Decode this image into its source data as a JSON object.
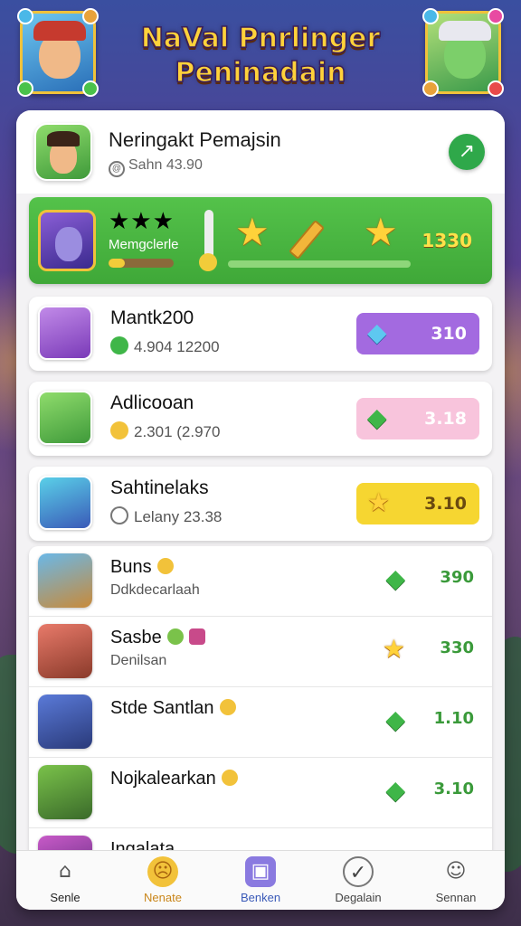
{
  "header": {
    "title_line1": "NaVal Pnrlinger",
    "title_line2": "Peninadain"
  },
  "profile": {
    "name": "Neringakt Pemajsin",
    "sub": "Sahn 43.90"
  },
  "featured": {
    "label": "Memgclerle",
    "score": "1330",
    "stars": "★★★",
    "progress_percent": 0,
    "mini_bar_percent": 25
  },
  "cards": [
    {
      "title": "Mantk200",
      "sub": "4.904 12200",
      "value": "310",
      "pill_color": "#a36ae0",
      "value_color": "#ffffff",
      "gem": "blue"
    },
    {
      "title": "Adlicooan",
      "sub": "2.301 (2.970",
      "value": "3.18",
      "pill_color": "#f8c4dc",
      "value_color": "#ffffff",
      "gem": "green"
    },
    {
      "title": "Sahtinelaks",
      "sub": "Lelany 23.38",
      "value": "3.10",
      "pill_color": "#f6d631",
      "value_color": "#6a4a10",
      "gem": "star"
    }
  ],
  "list": [
    {
      "name": "Buns",
      "sub": "Ddkdecarlaah",
      "value": "390",
      "gem": "green"
    },
    {
      "name": "Sasbe",
      "sub": "Denilsan",
      "value": "330",
      "gem": "star"
    },
    {
      "name": "Stde Santlan",
      "sub": "",
      "value": "1.10",
      "gem": "green"
    },
    {
      "name": "Nojkalearkan",
      "sub": "",
      "value": "3.10",
      "gem": "green"
    },
    {
      "name": "Ingalata",
      "sub": "",
      "value": "",
      "gem": "green"
    }
  ],
  "nav": [
    {
      "label": "Senle",
      "icon": "home-icon",
      "color": "#222222"
    },
    {
      "label": "Nenate",
      "icon": "emoji-icon",
      "color": "#c9861a"
    },
    {
      "label": "Benken",
      "icon": "cube-icon",
      "color": "#3a5ab8"
    },
    {
      "label": "Degalain",
      "icon": "check-circle-icon",
      "color": "#444444"
    },
    {
      "label": "Sennan",
      "icon": "face-icon",
      "color": "#444444"
    }
  ]
}
